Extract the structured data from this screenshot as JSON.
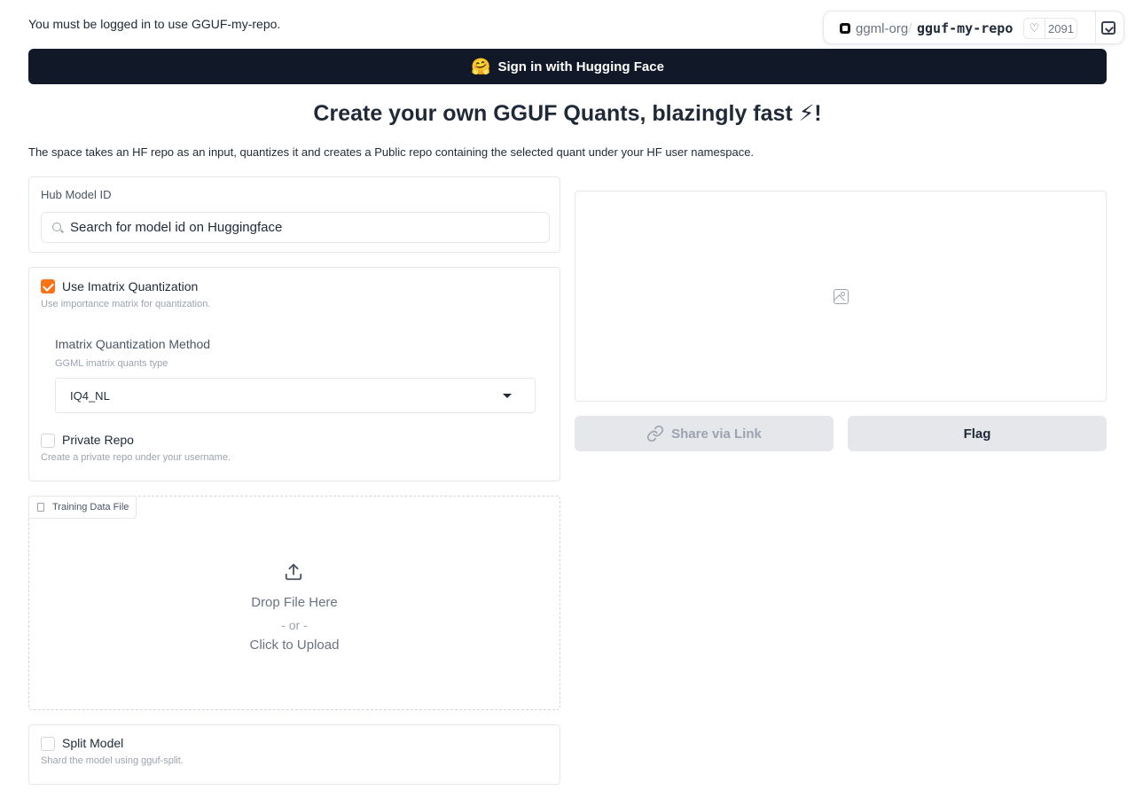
{
  "header": {
    "login_message": "You must be logged in to use GGUF-my-repo.",
    "signin_emoji": "🤗",
    "signin_label": "Sign in with Hugging Face"
  },
  "badge": {
    "org": "ggml-org",
    "slash": "/",
    "repo": "gguf-my-repo",
    "likes": "2091",
    "heart_icon": "heart-icon",
    "embed_icon": "embed-icon"
  },
  "main": {
    "title": "Create your own GGUF Quants, blazingly fast ⚡!",
    "description": "The space takes an HF repo as an input, quantizes it and creates a Public repo containing the selected quant under your HF user namespace."
  },
  "hub_model": {
    "label": "Hub Model ID",
    "placeholder": "Search for model id on Huggingface",
    "value": ""
  },
  "options": {
    "imatrix": {
      "label": "Use Imatrix Quantization",
      "info": "Use importance matrix for quantization.",
      "checked": true
    },
    "imatrix_method": {
      "label": "Imatrix Quantization Method",
      "info": "GGML imatrix quants type",
      "selected": "IQ4_NL"
    },
    "private_repo": {
      "label": "Private Repo",
      "info": "Create a private repo under your username.",
      "checked": false
    }
  },
  "upload": {
    "label": "Training Data File",
    "drop_text": "Drop File Here",
    "or_text": "- or -",
    "click_text": "Click to Upload"
  },
  "split": {
    "label": "Split Model",
    "info": "Shard the model using gguf-split.",
    "checked": false
  },
  "output": {
    "share_label": "Share via Link",
    "flag_label": "Flag"
  },
  "colors": {
    "accent": "#f97316",
    "signin_bg": "#111827"
  }
}
